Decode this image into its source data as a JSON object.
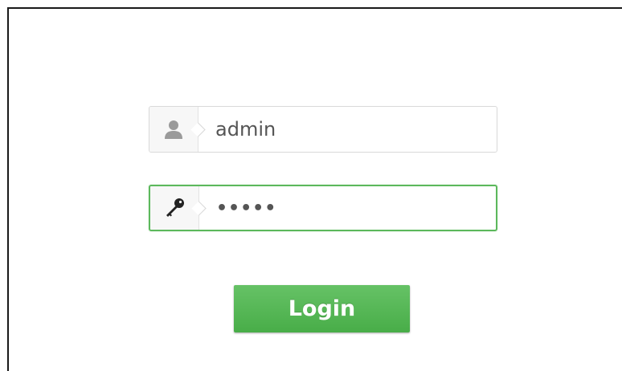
{
  "login_form": {
    "username": {
      "value": "admin",
      "icon": "user-icon"
    },
    "password": {
      "value": "•••••",
      "icon": "key-icon",
      "focused": true,
      "focus_color": "#5cb85c"
    },
    "login_button": {
      "label": "Login",
      "color": "#4cae4c"
    }
  }
}
